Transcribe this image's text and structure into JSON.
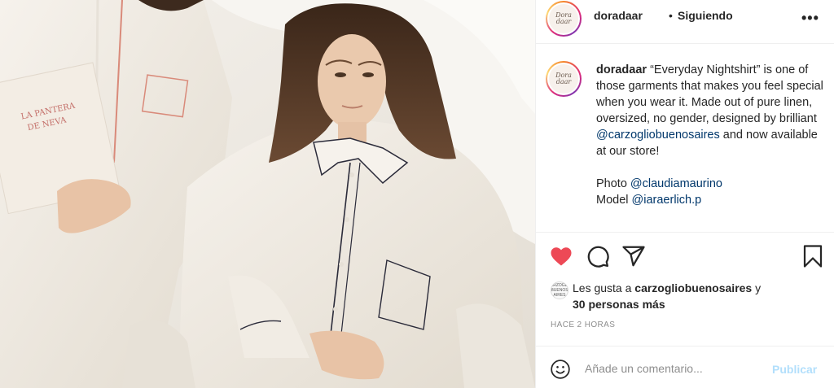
{
  "post": {
    "username": "doradaar",
    "avatar_logo_text": "Dora daar",
    "separator": "•",
    "follow_status": "Siguiendo",
    "more_label": "•••"
  },
  "caption": {
    "username": "doradaar",
    "text_part1": " “Everyday Nightshirt” is one of those garments that makes you feel special when you wear it. Made out of pure linen, oversized, no gender, designed by brilliant ",
    "mention1": "@carzogliobuenosaires",
    "text_part2": " and now available at our store!",
    "photo_label": "Photo ",
    "photo_mention": "@claudiamaurino",
    "model_label": "Model ",
    "model_mention": "@iaraerlich.p"
  },
  "actions": {
    "like_icon": "heart-filled-icon",
    "comment_icon": "comment-icon",
    "share_icon": "paper-plane-icon",
    "save_icon": "bookmark-icon",
    "like_color": "#ed4956"
  },
  "likes": {
    "avatar_text": "CARZOGLIO BUENOS AIRES",
    "prefix": "Les gusta a ",
    "user": "carzogliobuenosaires",
    "conjunction": " y",
    "others": "30 personas más"
  },
  "timestamp": "HACE 2 HORAS",
  "comment": {
    "placeholder": "Añade un comentario...",
    "publish_label": "Publicar",
    "publish_color": "#b2dffc"
  },
  "photo": {
    "book_title": "LA PANTERA DE NEVA"
  }
}
